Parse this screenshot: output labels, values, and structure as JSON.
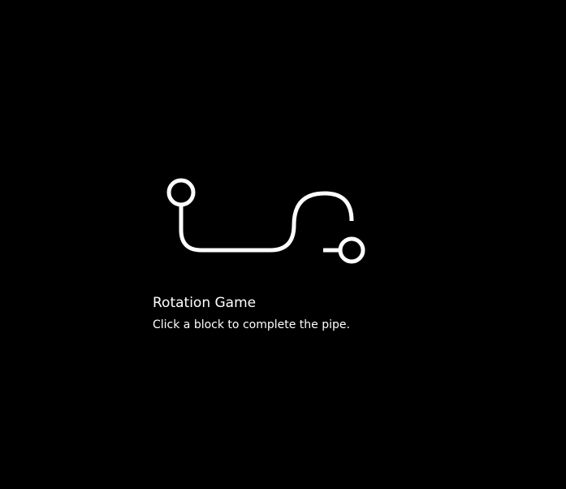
{
  "game": {
    "title": "Rotation Game",
    "instructions": "Click a block to complete the pipe.",
    "colors": {
      "background": "#000000",
      "pipe": "#ffffff"
    },
    "icons": {
      "start": "circle-endpoint",
      "end": "circle-endpoint"
    }
  }
}
